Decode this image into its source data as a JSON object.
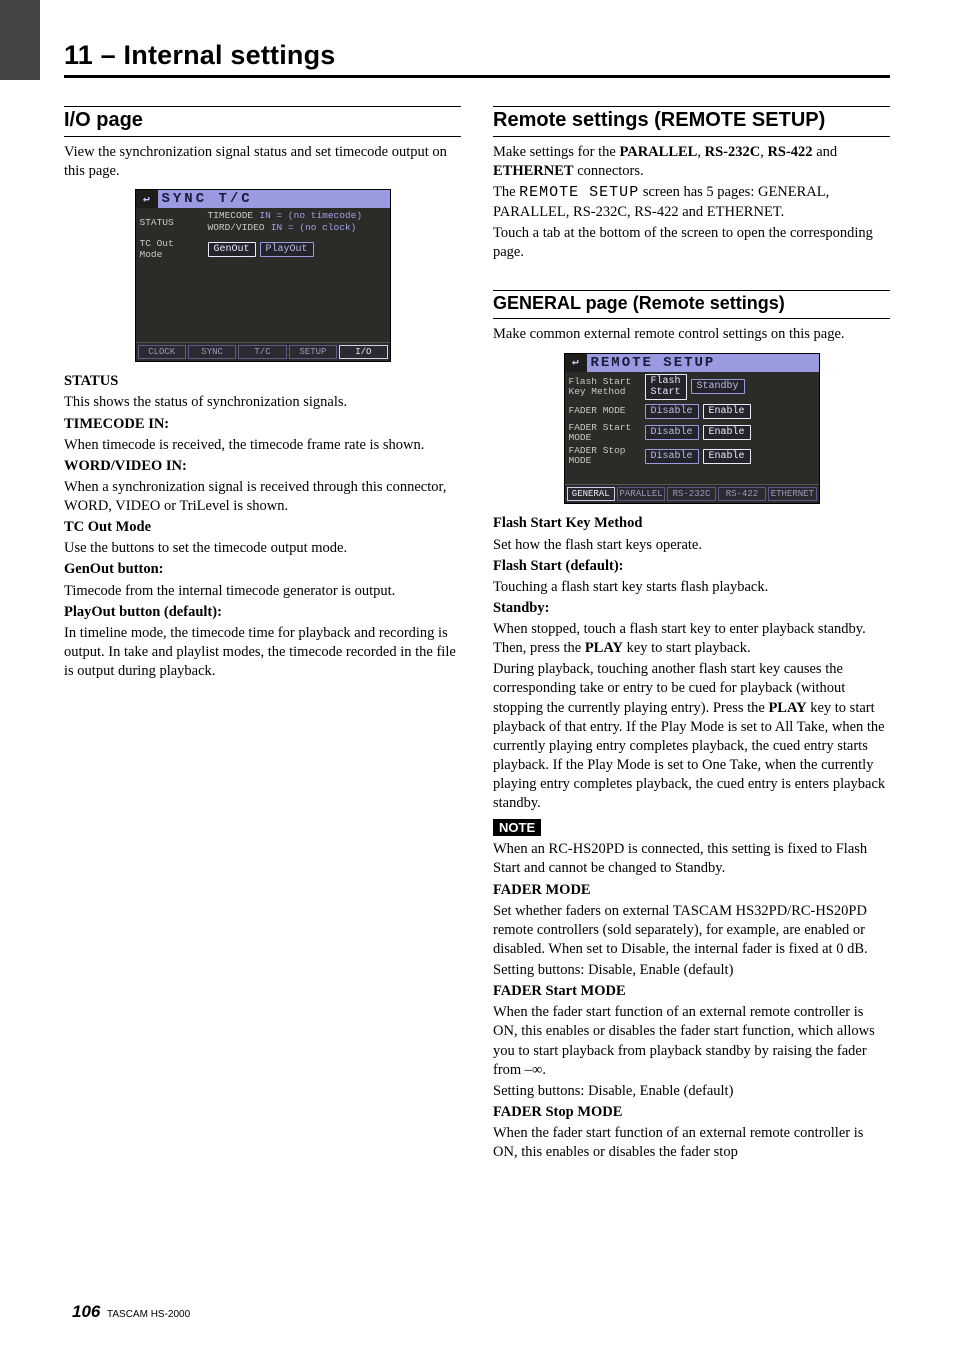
{
  "chapter": "11 – Internal settings",
  "footer": {
    "page": "106",
    "model": "TASCAM  HS-2000"
  },
  "left": {
    "h2": "I/O page",
    "intro": "View the synchronization signal status and set timecode output on this page.",
    "shot1": {
      "title": "SYNC T/C",
      "status_label": "STATUS",
      "tc_label": "TIMECODE",
      "tc_val": "IN = (no timecode)",
      "wv_label": "WORD/VIDEO",
      "wv_val": "IN = (no clock)",
      "mode_label": "TC Out\nMode",
      "btn_gen": "GenOut",
      "btn_play": "PlayOut",
      "tabs": [
        "CLOCK",
        "SYNC",
        "T/C",
        "SETUP",
        "I/O"
      ],
      "active_tab": 4
    },
    "status": {
      "h": "STATUS",
      "p": "This shows the status of synchronization signals.",
      "tc_h": "TIMECODE IN:",
      "tc_p": "When timecode is received, the timecode frame rate is shown.",
      "wv_h": "WORD/VIDEO IN:",
      "wv_p": "When a synchronization signal is received through this connector, WORD, VIDEO or TriLevel is shown."
    },
    "tcout": {
      "h": "TC Out Mode",
      "p": "Use the buttons to set the timecode output mode.",
      "gen_h": "GenOut button:",
      "gen_p": "Timecode from the internal timecode generator is output.",
      "play_h": "PlayOut button (default):",
      "play_p": "In timeline mode, the timecode time for playback and recording is output. In take and playlist modes, the timecode recorded in the file is output during playback."
    }
  },
  "right": {
    "h2": "Remote settings (REMOTE SETUP)",
    "intro1a": "Make settings for the ",
    "intro1b": "PARALLEL",
    "intro1c": ", ",
    "intro1d": "RS-232C",
    "intro1e": ", ",
    "intro1f": "RS-422",
    "intro1g": " and ",
    "intro1h": "ETHERNET",
    "intro1i": " connectors.",
    "intro2a": "The ",
    "intro2b": "REMOTE SETUP",
    "intro2c": " screen has 5 pages: GENERAL, PARALLEL, RS-232C, RS-422 and ETHERNET.",
    "intro3": "Touch a tab at the bottom of the screen to open the corresponding page.",
    "h3": "GENERAL page (Remote settings)",
    "h3_intro": "Make common external remote control settings on this page.",
    "shot2": {
      "title": "REMOTE SETUP",
      "rows": [
        {
          "label": "Flash Start\nKey Method",
          "opts": [
            "Flash\nStart",
            "Standby"
          ],
          "sel": 0
        },
        {
          "label": "FADER MODE",
          "opts": [
            "Disable",
            "Enable"
          ],
          "sel": 1
        },
        {
          "label": "FADER Start\nMODE",
          "opts": [
            "Disable",
            "Enable"
          ],
          "sel": 1
        },
        {
          "label": "FADER Stop\nMODE",
          "opts": [
            "Disable",
            "Enable"
          ],
          "sel": 1
        }
      ],
      "tabs": [
        "GENERAL",
        "PARALLEL",
        "RS-232C",
        "RS-422",
        "ETHERNET"
      ],
      "active_tab": 0
    },
    "flash": {
      "h": "Flash Start Key Method",
      "p": "Set how the flash start keys operate.",
      "def_h": "Flash Start (default):",
      "def_p": "Touching a flash start key starts flash playback.",
      "sb_h": "Standby:",
      "sb_p1a": "When stopped, touch a flash start key to enter playback standby. Then, press the ",
      "sb_p1b": "PLAY",
      "sb_p1c": " key to start playback.",
      "sb_p2a": "During playback, touching another flash start key causes the corresponding take or entry to be cued for playback (without stopping the currently playing entry). Press the ",
      "sb_p2b": "PLAY",
      "sb_p2c": " key to start playback of that entry. If the Play Mode is set to All Take, when the currently playing entry completes playback, the cued entry starts playback. If the Play Mode is set to One Take, when the currently playing entry completes playback, the cued entry is enters playback standby."
    },
    "note_label": "NOTE",
    "note_p": "When an RC-HS20PD is connected, this setting is fixed to Flash Start and cannot be changed to Standby.",
    "fader_mode": {
      "h": "FADER MODE",
      "p1": "Set whether faders on external TASCAM HS32PD/RC-HS20PD remote controllers (sold separately), for example, are enabled or disabled. When set to Disable, the internal fader is fixed at 0 dB.",
      "p2": "Setting buttons: Disable, Enable (default)"
    },
    "fader_start": {
      "h": "FADER Start MODE",
      "p1": "When the fader start function of an external remote controller is ON, this enables or disables the fader start function, which allows you to start playback from playback standby by raising the fader from –∞.",
      "p2": "Setting buttons: Disable, Enable (default)"
    },
    "fader_stop": {
      "h": "FADER Stop MODE",
      "p1": "When the fader start function of an external remote controller is ON, this enables or disables the fader stop"
    }
  }
}
